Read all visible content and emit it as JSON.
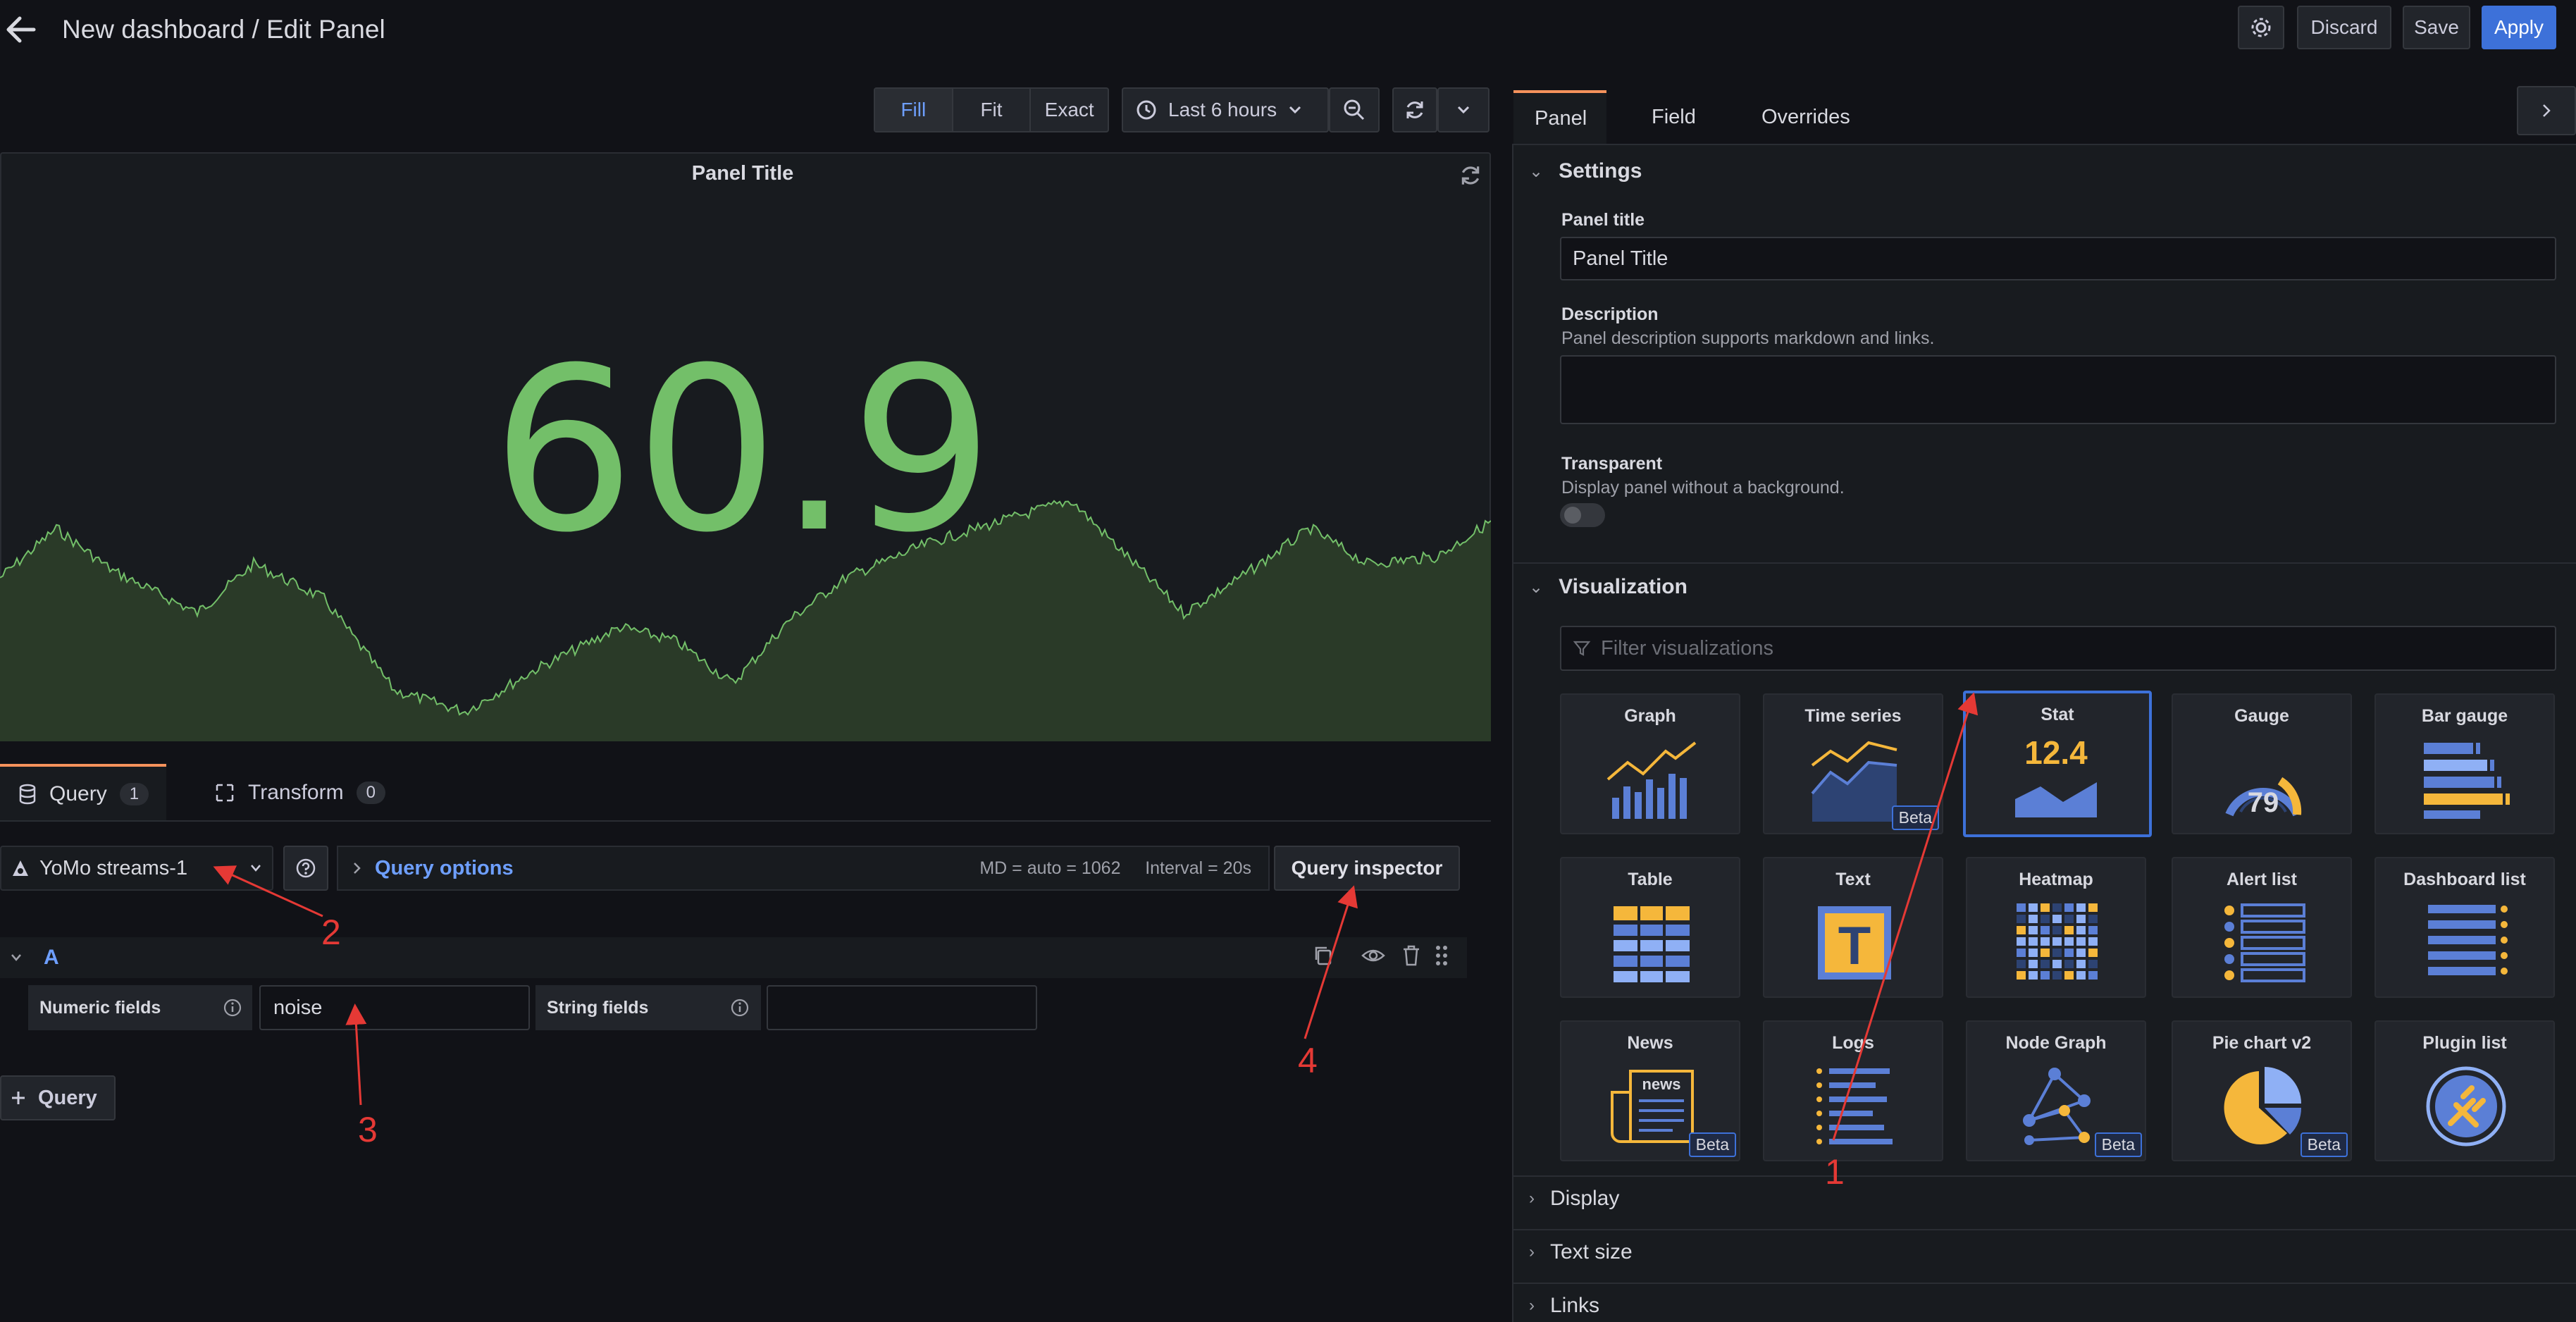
{
  "header": {
    "title": "New dashboard / Edit Panel",
    "discard_label": "Discard",
    "save_label": "Save",
    "apply_label": "Apply"
  },
  "toolbar": {
    "zoom_modes": [
      "Fill",
      "Fit",
      "Exact"
    ],
    "active_zoom_mode": "Fill",
    "time_range": "Last 6 hours"
  },
  "panel": {
    "title": "Panel Title",
    "stat_value": "60.9",
    "value_color": "#73bf69"
  },
  "query_tabs": [
    {
      "label": "Query",
      "count": "1"
    },
    {
      "label": "Transform",
      "count": "0"
    }
  ],
  "query": {
    "datasource": "YoMo streams-1",
    "options_label": "Query options",
    "meta": "MD = auto = 1062     Interval = 20s",
    "inspector_label": "Query inspector",
    "ref_id": "A",
    "numeric_label": "Numeric fields",
    "numeric_value": "noise",
    "string_label": "String fields",
    "string_value": "",
    "add_query_label": "Query"
  },
  "options": {
    "tabs": [
      "Panel",
      "Field",
      "Overrides"
    ],
    "active_tab": "Panel",
    "settings": {
      "heading": "Settings",
      "panel_title_label": "Panel title",
      "panel_title_value": "Panel Title",
      "description_label": "Description",
      "description_help": "Panel description supports markdown and links.",
      "transparent_label": "Transparent",
      "transparent_help": "Display panel without a background.",
      "transparent_on": false
    },
    "visualization": {
      "heading": "Visualization",
      "filter_placeholder": "Filter visualizations",
      "selected": "Stat",
      "items": [
        {
          "name": "Graph",
          "icon": "graph-icon",
          "beta": ""
        },
        {
          "name": "Time series",
          "icon": "time-series-icon",
          "beta": "Beta"
        },
        {
          "name": "Stat",
          "icon": "stat-icon",
          "beta": "",
          "sample": "12.4"
        },
        {
          "name": "Gauge",
          "icon": "gauge-icon",
          "beta": "",
          "sample": "79"
        },
        {
          "name": "Bar gauge",
          "icon": "bar-gauge-icon",
          "beta": ""
        },
        {
          "name": "Table",
          "icon": "table-icon",
          "beta": ""
        },
        {
          "name": "Text",
          "icon": "text-icon",
          "beta": "",
          "sample": "T"
        },
        {
          "name": "Heatmap",
          "icon": "heatmap-icon",
          "beta": ""
        },
        {
          "name": "Alert list",
          "icon": "alert-list-icon",
          "beta": ""
        },
        {
          "name": "Dashboard list",
          "icon": "dashboard-list-icon",
          "beta": ""
        },
        {
          "name": "News",
          "icon": "news-icon",
          "beta": "Beta",
          "sample": "news"
        },
        {
          "name": "Logs",
          "icon": "logs-icon",
          "beta": ""
        },
        {
          "name": "Node Graph",
          "icon": "node-graph-icon",
          "beta": "Beta"
        },
        {
          "name": "Pie chart v2",
          "icon": "pie-chart-icon",
          "beta": "Beta"
        },
        {
          "name": "Plugin list",
          "icon": "plugin-list-icon",
          "beta": ""
        }
      ]
    },
    "collapsed_sections": [
      "Display",
      "Text size",
      "Links"
    ]
  },
  "annotations": [
    "1",
    "2",
    "3",
    "4"
  ],
  "colors": {
    "accent": "#3d71d9",
    "tab_highlight": "#f5925c",
    "annotation": "#e53935",
    "viz_blue": "#5b7fd6",
    "viz_yellow": "#f5b73b"
  }
}
